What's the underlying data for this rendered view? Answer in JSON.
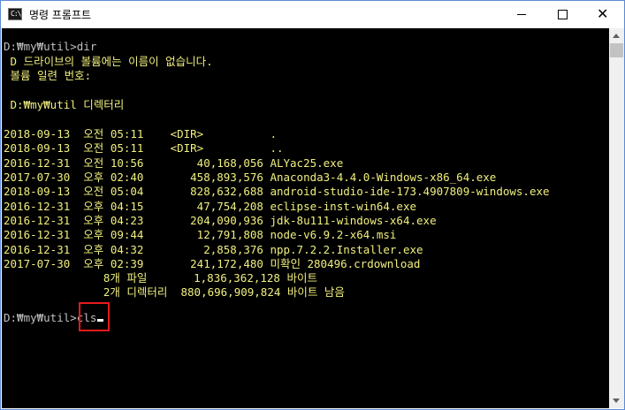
{
  "window": {
    "title": "명령 프롬프트",
    "icon_label": "C:\\",
    "controls": {
      "minimize": "minimize-icon",
      "maximize": "maximize-icon",
      "close": "✕"
    }
  },
  "console": {
    "command_line": "D:₩my₩util>dir",
    "volume_line": " D 드라이브의 볼륨에는 이름이 없습니다.",
    "serial_line": " 볼륨 일련 번호:",
    "directory_line": " D:₩my₩util 디렉터리",
    "entries": [
      "2018-09-13  오전 05:11    <DIR>          .",
      "2018-09-13  오전 05:11    <DIR>          ..",
      "2016-12-31  오전 10:56        40,168,056 ALYac25.exe",
      "2017-07-30  오후 02:40       458,893,576 Anaconda3-4.4.0-Windows-x86_64.exe",
      "2018-09-13  오전 05:04       828,632,688 android-studio-ide-173.4907809-windows.exe",
      "2016-12-31  오후 04:15        47,754,208 eclipse-inst-win64.exe",
      "2016-12-31  오후 04:23       204,090,936 jdk-8u111-windows-x64.exe",
      "2016-12-31  오후 09:44        12,791,808 node-v6.9.2-x64.msi",
      "2016-12-31  오후 04:32         2,858,376 npp.7.2.2.Installer.exe",
      "2017-07-30  오후 02:39       241,172,480 미확인 280496.crdownload"
    ],
    "summary_files": "               8개 파일       1,836,362,128 바이트",
    "summary_dirs": "               2개 디렉터리  880,696,909,824 바이트 남음",
    "prompt": "D:₩my₩util>",
    "typed_command": "cls"
  }
}
